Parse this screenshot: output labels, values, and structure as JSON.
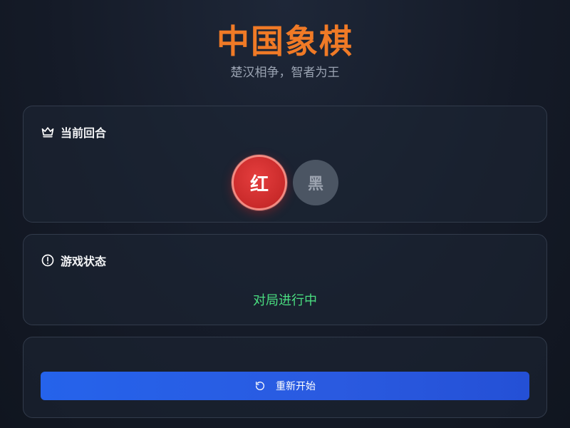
{
  "header": {
    "title": "中国象棋",
    "subtitle": "楚汉相争，智者为王"
  },
  "turn_panel": {
    "heading": "当前回合",
    "icon": "crown-icon",
    "red_label": "红",
    "black_label": "黑",
    "active": "red"
  },
  "status_panel": {
    "heading": "游戏状态",
    "icon": "alert-circle-icon",
    "status": "对局进行中"
  },
  "actions": {
    "restart_label": "重新开始",
    "restart_icon": "refresh-icon"
  },
  "colors": {
    "title": "#f07a26",
    "status": "#4ade80",
    "red_piece": "#d32f2f",
    "black_piece": "#4b5563",
    "button": "#2563eb"
  }
}
